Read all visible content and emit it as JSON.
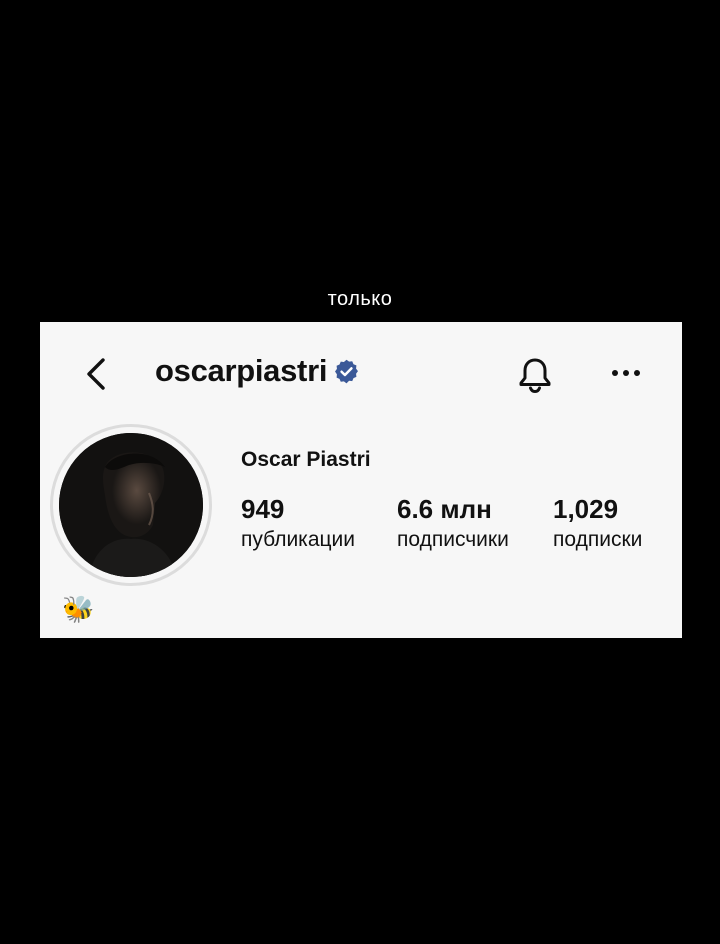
{
  "caption": "только",
  "profile": {
    "username": "oscarpiastri",
    "verified_color": "#3b5998",
    "full_name": "Oscar Piastri",
    "bio": "🐝",
    "stats": [
      {
        "value": "949",
        "label": "публикации"
      },
      {
        "value": "6.6 млн",
        "label": "подписчики"
      },
      {
        "value": "1,029",
        "label": "подписки"
      }
    ]
  },
  "icons": {
    "back": "chevron-left-icon",
    "verified": "verified-badge-icon",
    "notifications": "bell-icon",
    "more": "ellipsis-icon"
  },
  "colors": {
    "background": "#000000",
    "card": "#f7f7f7",
    "text": "#111111"
  }
}
